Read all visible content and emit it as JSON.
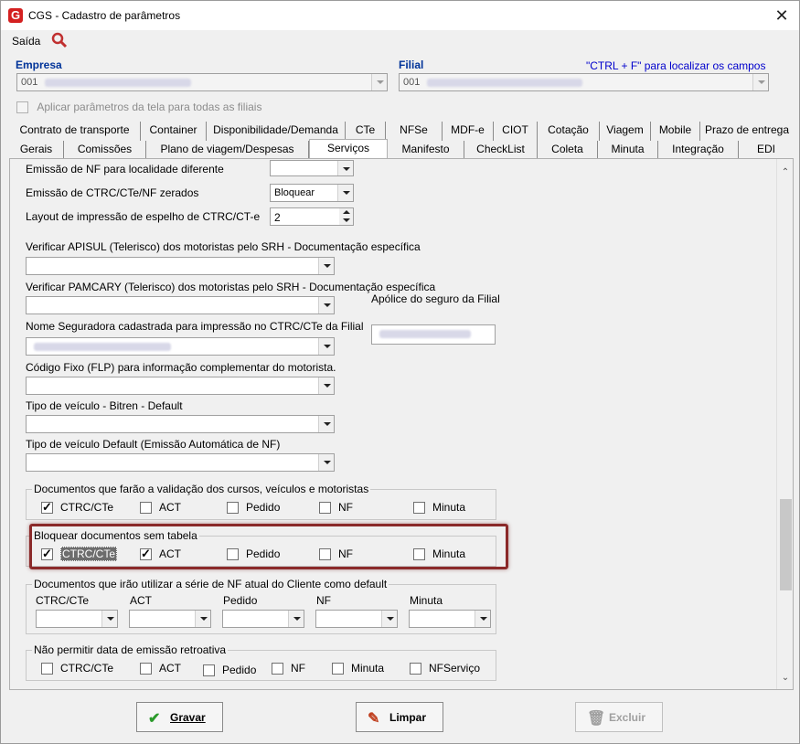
{
  "window": {
    "title": "CGS - Cadastro de parâmetros",
    "close_glyph": "✕"
  },
  "menu": {
    "exit_label": "Saída"
  },
  "header": {
    "empresa_label": "Empresa",
    "empresa_value": "001",
    "filial_label": "Filial",
    "filial_value": "001",
    "search_hint": "\"CTRL + F\" para localizar os campos",
    "apply_all_label": "Aplicar parâmetros da tela para todas as filiais"
  },
  "tabs_row1": [
    "Contrato de transporte",
    "Container",
    "Disponibilidade/Demanda",
    "CTe",
    "NFSe",
    "MDF-e",
    "CIOT",
    "Cotação",
    "Viagem",
    "Mobile",
    "Prazo de entrega"
  ],
  "tabs_row2": [
    "Gerais",
    "Comissões",
    "Plano de viagem/Despesas",
    "Serviços",
    "Manifesto",
    "CheckList",
    "Coleta",
    "Minuta",
    "Integração",
    "EDI"
  ],
  "active_tab": "Serviços",
  "fields": {
    "emissao_nf_label": "Emissão de NF para localidade diferente",
    "emissao_nf_value": "",
    "ctrc_zerados_label": "Emissão de CTRC/CTe/NF zerados",
    "ctrc_zerados_value": "Bloquear",
    "layout_label": "Layout de impressão de espelho de CTRC/CT-e",
    "layout_value": "2",
    "apisul_label": "Verificar APISUL (Telerisco) dos motoristas pelo SRH - Documentação específica",
    "pamcary_label": "Verificar PAMCARY (Telerisco) dos motoristas pelo SRH - Documentação específica",
    "apolice_label": "Apólice do seguro da Filial",
    "seguradora_label": "Nome Seguradora cadastrada para impressão no CTRC/CTe da Filial",
    "codigo_fixo_label": "Código Fixo (FLP) para informação complementar do motorista.",
    "bitren_label": "Tipo de veículo - Bitren - Default",
    "tipo_veiculo_label": "Tipo de veículo Default (Emissão Automática de NF)"
  },
  "group_validacao": {
    "title": "Documentos que farão a validação dos cursos, veículos e motoristas",
    "items": [
      {
        "label": "CTRC/CTe",
        "checked": true
      },
      {
        "label": "ACT",
        "checked": false
      },
      {
        "label": "Pedido",
        "checked": false
      },
      {
        "label": "NF",
        "checked": false
      },
      {
        "label": "Minuta",
        "checked": false
      }
    ]
  },
  "group_bloquear": {
    "title": "Bloquear documentos sem tabela",
    "items": [
      {
        "label": "CTRC/CTe",
        "checked": true
      },
      {
        "label": "ACT",
        "checked": true
      },
      {
        "label": "Pedido",
        "checked": false
      },
      {
        "label": "NF",
        "checked": false
      },
      {
        "label": "Minuta",
        "checked": false
      }
    ]
  },
  "group_serie": {
    "title": "Documentos que irão utilizar a série de NF atual do Cliente  como default",
    "columns": [
      "CTRC/CTe",
      "ACT",
      "Pedido",
      "NF",
      "Minuta"
    ]
  },
  "group_retroativa": {
    "title": "Não permitir data de emissão retroativa",
    "items": [
      {
        "label": "CTRC/CTe",
        "checked": false
      },
      {
        "label": "ACT",
        "checked": false
      },
      {
        "label": "Pedido",
        "checked": false
      },
      {
        "label": "NF",
        "checked": false
      },
      {
        "label": "Minuta",
        "checked": false
      },
      {
        "label": "NFServiço",
        "checked": false
      }
    ]
  },
  "buttons": {
    "gravar": "Gravar",
    "limpar": "Limpar",
    "excluir": "Excluir"
  },
  "colors": {
    "accent_label": "#003399",
    "hint": "#0000cc",
    "highlight_border": "#8b2a2a"
  }
}
